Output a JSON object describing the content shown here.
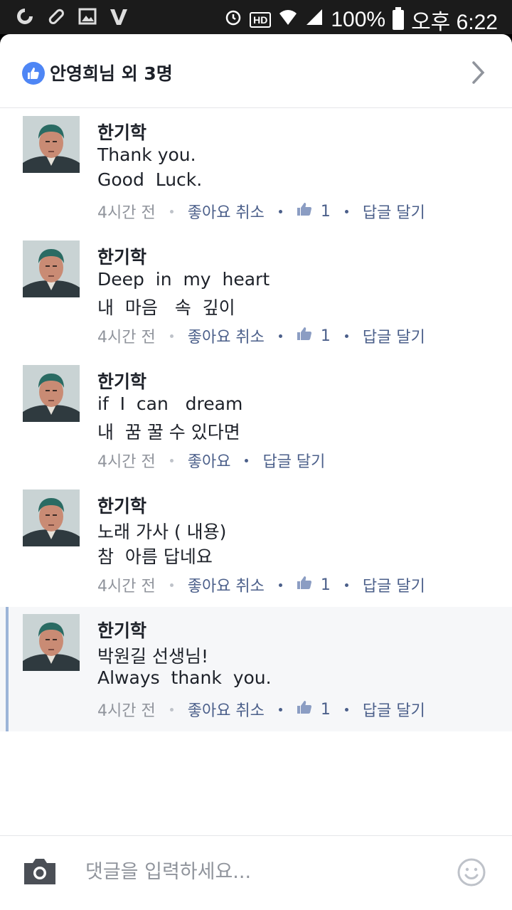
{
  "status_bar": {
    "battery": "100%",
    "time": "오후 6:22",
    "hd_label": "HD"
  },
  "likes": {
    "summary": "안영희님 외 3명"
  },
  "comments": [
    {
      "author": "한기학",
      "line1": "Thank you.",
      "line2": "Good  Luck.",
      "time": "4시간 전",
      "like_action": "좋아요 취소",
      "like_count": "1",
      "reply": "답글 달기",
      "highlighted": false
    },
    {
      "author": "한기학",
      "line1": "Deep  in  my  heart",
      "line2": "내  마음   속  깊이",
      "time": "4시간 전",
      "like_action": "좋아요 취소",
      "like_count": "1",
      "reply": "답글 달기",
      "highlighted": false
    },
    {
      "author": "한기학",
      "line1": "if  I  can   dream",
      "line2": "내  꿈 꿀 수 있다면",
      "time": "4시간 전",
      "like_action": "좋아요",
      "like_count": "",
      "reply": "답글 달기",
      "highlighted": false
    },
    {
      "author": "한기학",
      "line1": "노래 가사 ( 내용)",
      "line2": "참  아름 답네요",
      "time": "4시간 전",
      "like_action": "좋아요 취소",
      "like_count": "1",
      "reply": "답글 달기",
      "highlighted": false
    },
    {
      "author": "한기학",
      "line1": "박원길 선생님!",
      "line2": "Always  thank  you.",
      "time": "4시간 전",
      "like_action": "좋아요 취소",
      "like_count": "1",
      "reply": "답글 달기",
      "highlighted": true
    }
  ],
  "composer": {
    "placeholder": "댓글을 입력하세요..."
  },
  "colors": {
    "accent": "#4b5f8a",
    "like_blue": "#4e86f5",
    "highlight_bg": "#f6f7f9"
  }
}
